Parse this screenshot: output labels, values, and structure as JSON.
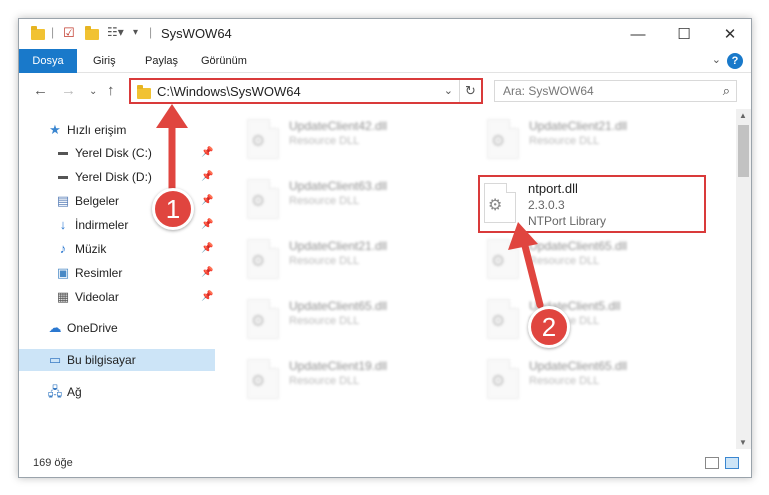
{
  "window": {
    "title": "SysWOW64",
    "minimize_glyph": "—",
    "maximize_glyph": "☐",
    "close_glyph": "✕"
  },
  "ribbon": {
    "tabs": [
      {
        "label": "Dosya"
      },
      {
        "label": "Giriş"
      },
      {
        "label": "Paylaş"
      },
      {
        "label": "Görünüm"
      }
    ],
    "help_glyph": "?"
  },
  "nav": {
    "address": "C:\\Windows\\SysWOW64",
    "search_placeholder": "Ara: SysWOW64"
  },
  "sidebar": {
    "items": [
      {
        "label": "Hızlı erişim",
        "icon": "star-icon"
      },
      {
        "label": "Yerel Disk (C:)",
        "icon": "drive-icon"
      },
      {
        "label": "Yerel Disk (D:)",
        "icon": "drive-icon"
      },
      {
        "label": "Belgeler",
        "icon": "documents-icon"
      },
      {
        "label": "İndirmeler",
        "icon": "download-icon"
      },
      {
        "label": "Müzik",
        "icon": "music-icon"
      },
      {
        "label": "Resimler",
        "icon": "pictures-icon"
      },
      {
        "label": "Videolar",
        "icon": "video-icon"
      },
      {
        "label": "OneDrive",
        "icon": "cloud-icon"
      },
      {
        "label": "Bu bilgisayar",
        "icon": "computer-icon"
      },
      {
        "label": "Ağ",
        "icon": "network-icon"
      }
    ]
  },
  "files": [
    {
      "name": "UpdateClient42.dll",
      "type": "Resource DLL"
    },
    {
      "name": "UpdateClient21.dll",
      "type": "Resource DLL"
    },
    {
      "name": "UpdateClient63.dll",
      "type": "Resource DLL"
    },
    {
      "name": "ntport.dll",
      "version": "2.3.0.3",
      "description": "NTPort Library"
    },
    {
      "name": "UpdateClient21.dll",
      "type": "Resource DLL"
    },
    {
      "name": "UpdateClient65.dll",
      "type": "Resource DLL"
    },
    {
      "name": "UpdateClient65.dll",
      "type": "Resource DLL"
    },
    {
      "name": "UpdateClient5.dll",
      "type": "Resource DLL"
    },
    {
      "name": "UpdateClient19.dll",
      "type": "Resource DLL"
    },
    {
      "name": "UpdateClient65.dll",
      "type": "Resource DLL"
    }
  ],
  "status": {
    "item_count": "169 öğe"
  },
  "annotations": {
    "badge1": "1",
    "badge2": "2",
    "color": "#e0453f"
  }
}
